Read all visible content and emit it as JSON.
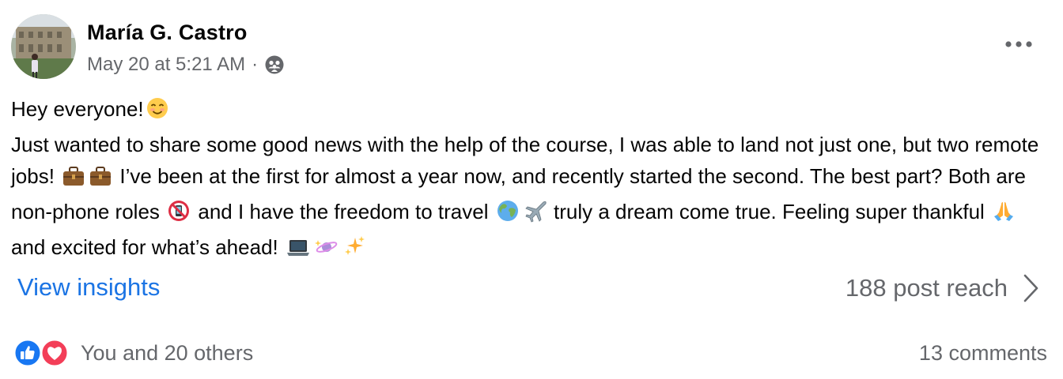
{
  "post": {
    "author": "María G. Castro",
    "timestamp": "May 20 at 5:21 AM",
    "separator": "·",
    "audience_icon": "friends-icon",
    "more_icon": "more-dots-icon",
    "body": {
      "line1": "Hey everyone!",
      "line1_emoji": "smiling-face-icon",
      "para2_part1": "Just wanted to share some good news with the help of the course, I was able to land not just one, but two remote jobs!",
      "para2_part2": "I’ve been at the first for almost a year now, and recently started the second. The best part? Both are non-phone roles",
      "para2_part3": "and I have the freedom to travel",
      "para2_part4": "truly a dream come true. Feeling super thankful",
      "para2_part5": "and excited for what’s ahead!"
    },
    "insights": {
      "view_insights_label": "View insights",
      "reach_label": "188 post reach",
      "chevron_icon": "chevron-right-icon"
    },
    "reactions": {
      "icons": [
        "like-icon",
        "love-icon"
      ],
      "reactors_label": "You and 20 others",
      "comments_label": "13 comments"
    },
    "colors": {
      "link_blue": "#1b74e4",
      "secondary_text": "#65676b",
      "like_blue": "#1877f2",
      "love_red": "#f33e58"
    }
  }
}
